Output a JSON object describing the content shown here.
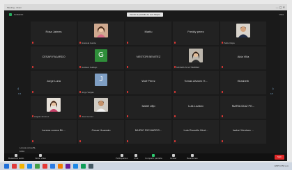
{
  "window": {
    "title": "Meeting - Zoom",
    "subtitle": "Grabando",
    "banner": "Viendo la pantalla de Luis Mojica",
    "view": "Vista"
  },
  "participants": [
    {
      "name": "Rosa Jaimes",
      "label": "",
      "avatar": "none"
    },
    {
      "name": "",
      "label": "Graciela Garcia",
      "avatar": "photo-woman"
    },
    {
      "name": "Marilu",
      "label": "",
      "avatar": "none"
    },
    {
      "name": "Freddy perez",
      "label": "",
      "avatar": "none"
    },
    {
      "name": "",
      "label": "Pablo Mejia",
      "avatar": "photo-man"
    },
    {
      "name": "CESAR FAJARDO",
      "label": "",
      "avatar": "none"
    },
    {
      "name": "",
      "label": "Gustavo Gallego",
      "avatar": "G",
      "color": "#2f8f3a"
    },
    {
      "name": "NESTOR BENITEZ",
      "label": "",
      "avatar": "none"
    },
    {
      "name": "",
      "label": "MAYERLIS GUTIERREZ",
      "avatar": "photo-woman2"
    },
    {
      "name": "Aida Villa",
      "label": "",
      "avatar": "none"
    },
    {
      "name": "Jorge Luna",
      "label": "",
      "avatar": "none"
    },
    {
      "name": "",
      "label": "Jorge Vargas",
      "avatar": "J",
      "color": "#7f9fc4"
    },
    {
      "name": "Wolf Pérez",
      "label": "",
      "avatar": "none"
    },
    {
      "name": "Tomas Alvarez H...",
      "label": "",
      "avatar": "none"
    },
    {
      "name": "Elizabeth",
      "label": "",
      "avatar": "none"
    },
    {
      "name": "",
      "label": "Angela Jimenez",
      "avatar": "photo-woman3"
    },
    {
      "name": "",
      "label": "Jose Gomez",
      "avatar": "photo-man2"
    },
    {
      "name": "Isabel ufijo",
      "label": "",
      "avatar": "none"
    },
    {
      "name": "Luis Lozano",
      "label": "",
      "avatar": "none"
    },
    {
      "name": "MARIA DIAZ PE...",
      "label": "",
      "avatar": "none"
    },
    {
      "name": "Lorena correa BL...",
      "label": "",
      "avatar": "none"
    },
    {
      "name": "Cesar Huamán",
      "label": "",
      "avatar": "none"
    },
    {
      "name": "MURIC RICHARDS...",
      "label": "",
      "avatar": "none"
    },
    {
      "name": "Luis Escarlin Mort...",
      "label": "",
      "avatar": "none"
    },
    {
      "name": "Isabel Ventura ...",
      "label": "",
      "avatar": "none"
    }
  ],
  "nav": {
    "left_arrow": "‹",
    "right_arrow": "›",
    "left_page": "1/3",
    "right_page": "1/3"
  },
  "speaker_note": [
    "Lorena correa BL",
    "FAJA"
  ],
  "toolbar": [
    {
      "label": "Desactivar audio",
      "icon": "mic-icon",
      "color": "#cfcfcf"
    },
    {
      "label": "Iniciar video",
      "icon": "video-icon",
      "color": "#cfcfcf"
    },
    {
      "label": "Participantes",
      "icon": "participants-icon",
      "color": "#cfcfcf"
    },
    {
      "label": "Chat",
      "icon": "chat-icon",
      "color": "#cfcfcf"
    },
    {
      "label": "Compartir pantalla",
      "icon": "share-icon",
      "color": "#2ecc71"
    },
    {
      "label": "Grabar",
      "icon": "record-icon",
      "color": "#cfcfcf"
    },
    {
      "label": "Reacciones",
      "icon": "reactions-icon",
      "color": "#cfcfcf"
    }
  ],
  "end_label": "Salir",
  "taskbar": {
    "icons": [
      "#1e6fd9",
      "#e03a3a",
      "#f4b400",
      "#1e88e5",
      "#43a047",
      "#e53935",
      "#2b7be4",
      "#f57c00",
      "#6a1b9a",
      "#1e88e5",
      "#0f9d58",
      "#455a64"
    ],
    "tray": "ESP 10:52 a.m."
  }
}
